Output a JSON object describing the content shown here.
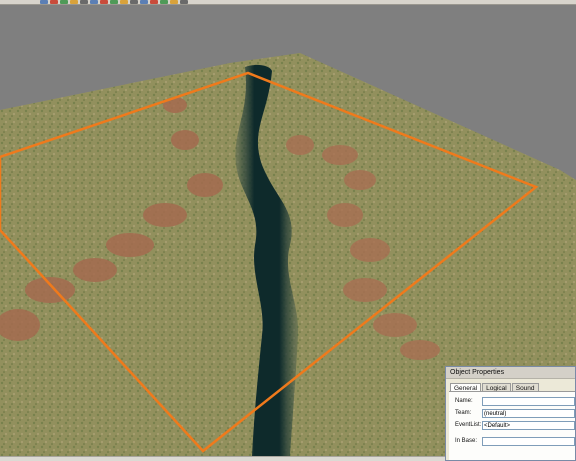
{
  "toolbar": {
    "buttons": [
      "open-icon",
      "save-icon",
      "undo-icon",
      "redo-icon",
      "select-icon",
      "move-icon",
      "rotate-icon",
      "terrain-icon",
      "water-icon",
      "road-icon",
      "object-icon",
      "waypoint-icon",
      "light-icon",
      "camera-icon",
      "grid-icon"
    ]
  },
  "statusbar": {
    "text": ""
  },
  "object_properties": {
    "title": "Object Properties",
    "tabs": [
      "General",
      "Logical",
      "Sound"
    ],
    "active_tab": "General",
    "fields": {
      "name_label": "Name:",
      "name_value": "",
      "team_label": "Team:",
      "team_value": "(neutral)",
      "eventlist_label": "EventList:",
      "eventlist_value": "<Default>",
      "inbase_label": "In Base:",
      "inbase_value": ""
    }
  },
  "colors": {
    "boundary": "#ef7a1c",
    "river": "#0d2b2b",
    "ground": "#9a9862",
    "rock": "#a16a4f",
    "background": "#7f7f7f"
  }
}
